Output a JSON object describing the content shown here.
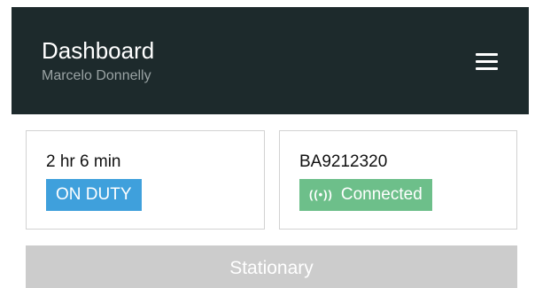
{
  "header": {
    "title": "Dashboard",
    "subtitle": "Marcelo Donnelly",
    "menu_icon": "hamburger-menu-icon"
  },
  "cards": {
    "duty": {
      "time": "2 hr 6 min",
      "status": "ON DUTY",
      "status_color": "#3fa0dc"
    },
    "device": {
      "id": "BA9212320",
      "signal_icon": "((•))",
      "status": "Connected",
      "status_color": "#6dbf8a"
    }
  },
  "status_bar": {
    "label": "Stationary",
    "color": "#cccccc"
  },
  "colors": {
    "header_bg": "#1d2a2c"
  }
}
